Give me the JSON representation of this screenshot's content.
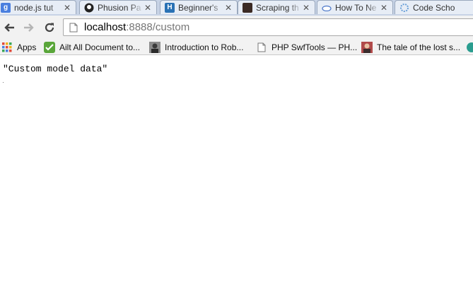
{
  "tabs": [
    {
      "title": "node.js tut",
      "icon": "google-icon"
    },
    {
      "title": "Phusion Pa",
      "icon": "github-icon"
    },
    {
      "title": "Beginner's",
      "icon": "h-icon"
    },
    {
      "title": "Scraping th",
      "icon": "avatar-icon"
    },
    {
      "title": "How To Ne",
      "icon": "cloud-icon"
    },
    {
      "title": "Code Scho",
      "icon": "gear-icon"
    }
  ],
  "toolbar": {
    "url_host": "localhost",
    "url_rest": ":8888/custom"
  },
  "bookmarks": [
    {
      "label": "Apps",
      "icon": "apps-grid-icon"
    },
    {
      "label": "Ailt All Document to...",
      "icon": "checkmark-icon"
    },
    {
      "label": "Introduction to Rob...",
      "icon": "avatar-icon"
    },
    {
      "label": "PHP SwfTools — PH...",
      "icon": "page-icon"
    },
    {
      "label": "The tale of the lost s...",
      "icon": "avatar-icon"
    }
  ],
  "content": {
    "text": "\"Custom model data\""
  },
  "colors": {
    "tabstrip": "#c7d3e6",
    "toolbar": "#f2f2f2",
    "page": "#ffffff"
  }
}
